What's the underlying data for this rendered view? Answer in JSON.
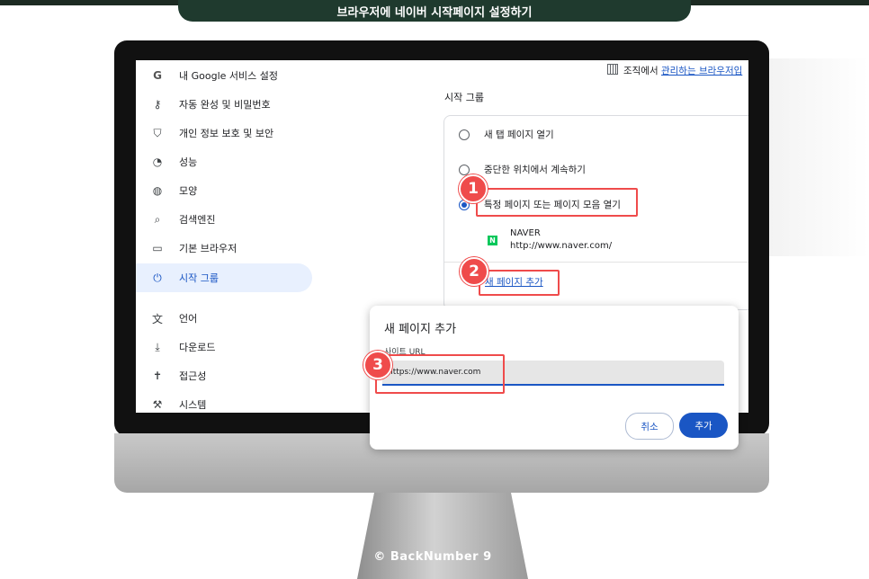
{
  "banner": {
    "title": "브라우저에 네이버 시작페이지 설정하기"
  },
  "sidebar": {
    "items": [
      {
        "icon": "google-icon",
        "glyph": "G",
        "label": "내 Google 서비스 설정"
      },
      {
        "icon": "key-icon",
        "glyph": "⚷",
        "label": "자동 완성 및 비밀번호"
      },
      {
        "icon": "shield-icon",
        "glyph": "⛉",
        "label": "개인 정보 보호 및 보안"
      },
      {
        "icon": "speedometer-icon",
        "glyph": "◔",
        "label": "성능"
      },
      {
        "icon": "palette-icon",
        "glyph": "◍",
        "label": "모양"
      },
      {
        "icon": "search-icon",
        "glyph": "⌕",
        "label": "검색엔진"
      },
      {
        "icon": "browser-icon",
        "glyph": "▭",
        "label": "기본 브라우저"
      },
      {
        "icon": "power-icon",
        "glyph": "⏻",
        "label": "시작 그룹",
        "active": true
      },
      {
        "icon": "translate-icon",
        "glyph": "文",
        "label": "언어"
      },
      {
        "icon": "download-icon",
        "glyph": "⤓",
        "label": "다운로드"
      },
      {
        "icon": "accessibility-icon",
        "glyph": "✝",
        "label": "접근성"
      },
      {
        "icon": "wrench-icon",
        "glyph": "⚒",
        "label": "시스템"
      }
    ]
  },
  "managed": {
    "prefix": "조직에서 ",
    "link": "관리하는 브라우저입"
  },
  "startup": {
    "title": "시작 그룹",
    "options": [
      {
        "label": "새 탭 페이지 열기",
        "checked": false
      },
      {
        "label": "중단한 위치에서 계속하기",
        "checked": false
      },
      {
        "label": "특정 페이지 또는 페이지 모음 열기",
        "checked": true
      }
    ],
    "site": {
      "favicon": "N",
      "name": "NAVER",
      "url": "http://www.naver.com/"
    },
    "add_link": "새 페이지 추가"
  },
  "dialog": {
    "title": "새 페이지 추가",
    "field_label": "사이트 URL",
    "field_value": "https://www.naver.com",
    "cancel_label": "취소",
    "add_label": "추가"
  },
  "steps": [
    "1",
    "2",
    "3"
  ],
  "watermark": "© BackNumber 9",
  "colors": {
    "accent": "#1a56c4",
    "callout": "#ef4b4b",
    "banner": "#1f3a2e"
  }
}
